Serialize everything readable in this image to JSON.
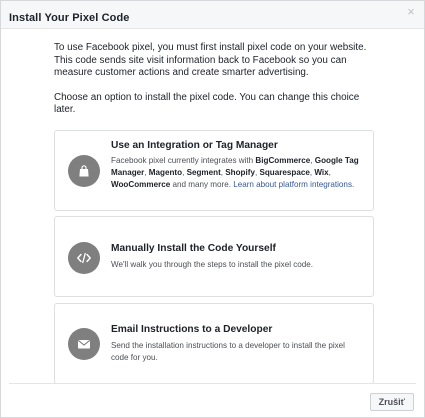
{
  "dialog": {
    "title": "Install Your Pixel Code",
    "close_glyph": "×"
  },
  "intro": "To use Facebook pixel, you must first install pixel code on your website. This code sends site visit information back to Facebook so you can measure customer actions and create smarter advertising.",
  "choose": "Choose an option to install the pixel code. You can change this choice later.",
  "options": [
    {
      "icon": "shopping-bag-icon",
      "title": "Use an Integration or Tag Manager",
      "desc_prefix": "Facebook pixel currently integrates with ",
      "partners": [
        "BigCommerce",
        "Google Tag Manager",
        "Magento",
        "Segment",
        "Shopify",
        "Squarespace",
        "Wix",
        "WooCommerce"
      ],
      "desc_suffix": " and many more. ",
      "link": "Learn about platform integrations."
    },
    {
      "icon": "code-icon",
      "title": "Manually Install the Code Yourself",
      "desc": "We'll walk you through the steps to install the pixel code."
    },
    {
      "icon": "envelope-icon",
      "title": "Email Instructions to a Developer",
      "desc": "Send the installation instructions to a developer to install the pixel code for you."
    }
  ],
  "footer": {
    "cancel_label": "Zrušiť"
  }
}
